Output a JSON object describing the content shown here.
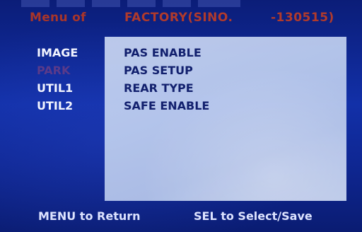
{
  "header": {
    "menu_of": "Menu of",
    "factory": "FACTORY(SINO.",
    "code": "-130515)"
  },
  "left_menu": [
    {
      "label": "IMAGE",
      "highlighted": false
    },
    {
      "label": "PARK",
      "highlighted": true
    },
    {
      "label": "UTIL1",
      "highlighted": false
    },
    {
      "label": "UTIL2",
      "highlighted": false
    }
  ],
  "panel_items": [
    {
      "label": "PAS ENABLE"
    },
    {
      "label": "PAS SETUP"
    },
    {
      "label": "REAR TYPE"
    },
    {
      "label": "SAFE ENABLE"
    }
  ],
  "footer": {
    "left": "MENU to Return",
    "right": "SEL to Select/Save"
  },
  "colors": {
    "background": "#1230a8",
    "header_text": "#b03a2c",
    "menu_text": "#f2f4ff",
    "selected_menu_text": "#5a3a8a",
    "panel": "#c4d2f0",
    "panel_text": "#12206e"
  }
}
